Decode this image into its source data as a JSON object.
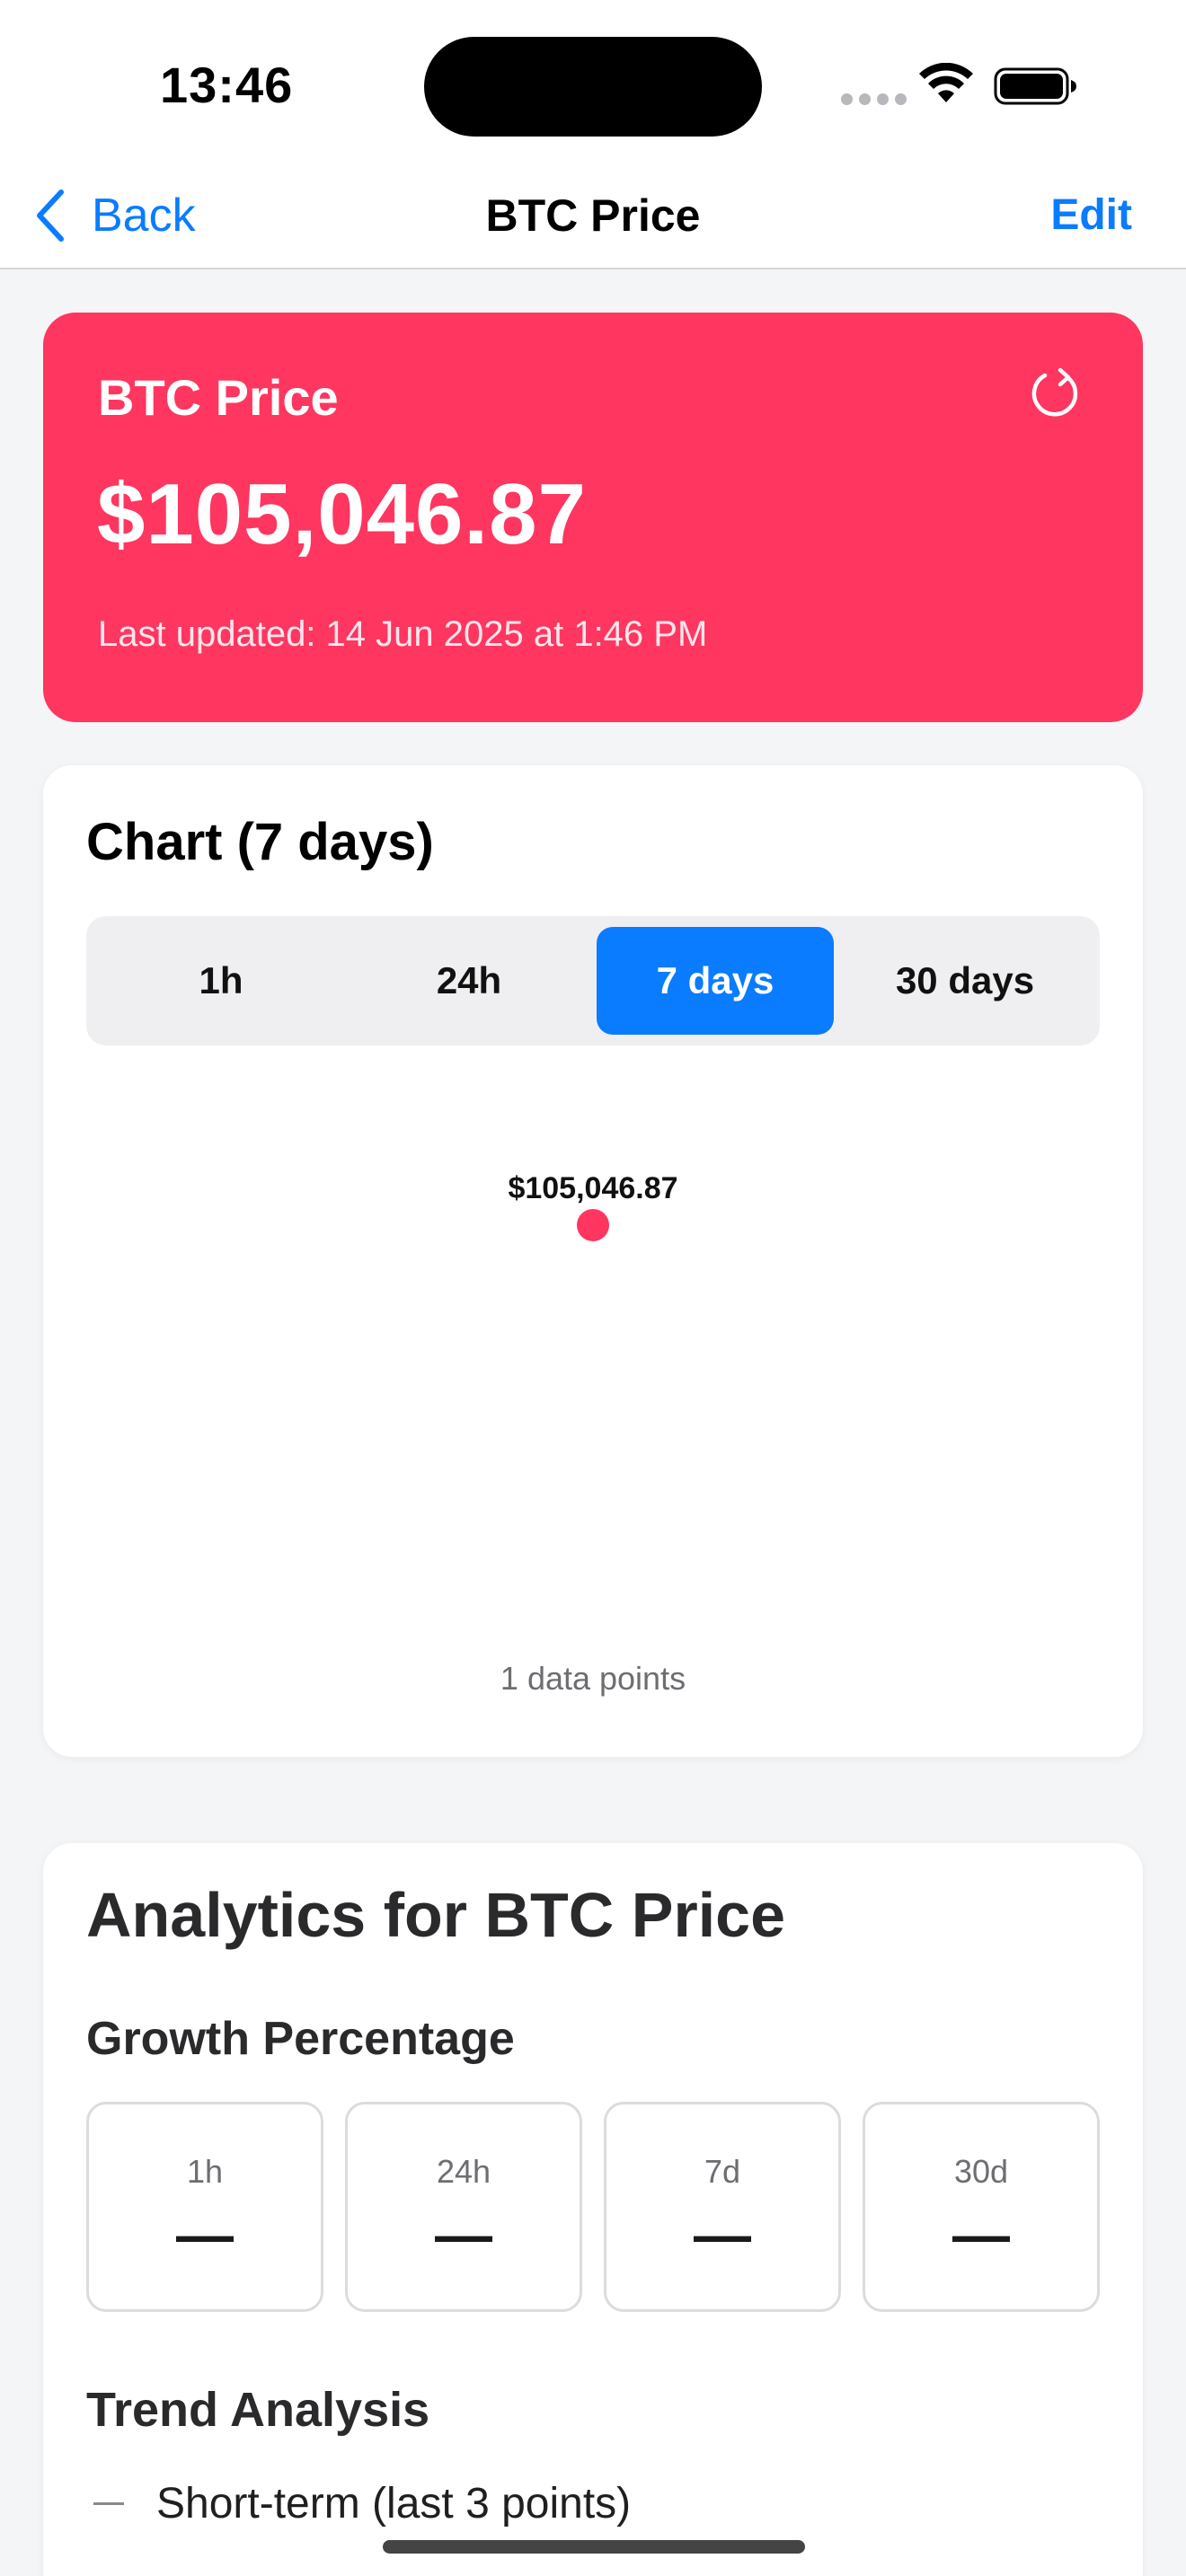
{
  "status_bar": {
    "time": "13:46"
  },
  "nav": {
    "back_label": "Back",
    "title": "BTC Price",
    "edit_label": "Edit"
  },
  "price_card": {
    "title": "BTC Price",
    "value": "$105,046.87",
    "last_updated": "Last updated: 14 Jun 2025 at 1:46 PM",
    "accent_color": "#fe3660",
    "refresh_icon": "refresh-icon"
  },
  "chart_card": {
    "title": "Chart (7 days)",
    "ranges": [
      {
        "label": "1h",
        "selected": false
      },
      {
        "label": "24h",
        "selected": false
      },
      {
        "label": "7 days",
        "selected": true
      },
      {
        "label": "30 days",
        "selected": false
      }
    ],
    "data_count_label": "1 data points",
    "selected_color": "#0a7cff"
  },
  "chart_data": {
    "type": "scatter",
    "title": "",
    "xlabel": "",
    "ylabel": "",
    "series": [
      {
        "values": [
          105046.87
        ],
        "labels": [
          "$105,046.87"
        ],
        "color": "#fe3660"
      }
    ],
    "grid": false,
    "legend": "none"
  },
  "analytics": {
    "title": "Analytics for BTC Price",
    "growth_heading": "Growth Percentage",
    "growth": [
      {
        "label": "1h",
        "value": "—"
      },
      {
        "label": "24h",
        "value": "—"
      },
      {
        "label": "7d",
        "value": "—"
      },
      {
        "label": "30d",
        "value": "—"
      }
    ],
    "trend_heading": "Trend Analysis",
    "trend_items": [
      {
        "label": "Short-term (last 3 points)"
      }
    ]
  }
}
